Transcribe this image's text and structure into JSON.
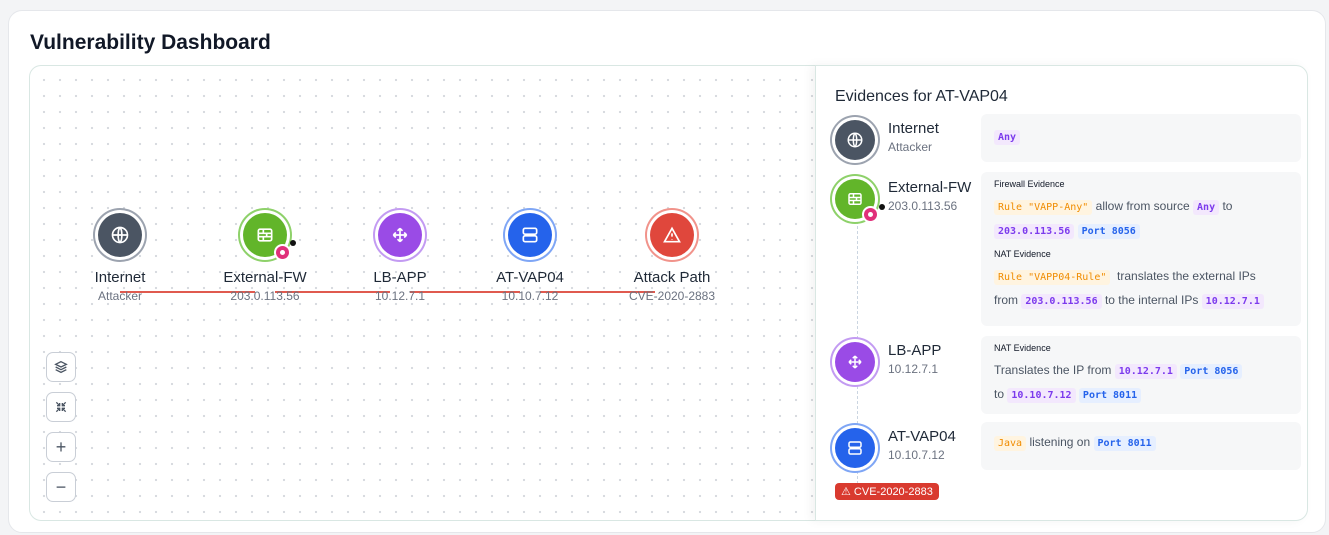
{
  "page": {
    "title": "Vulnerability Dashboard"
  },
  "graph": {
    "nodes": [
      {
        "name": "Internet",
        "sub": "Attacker",
        "icon": "globe-icon"
      },
      {
        "name": "External-FW",
        "sub": "203.0.113.56",
        "icon": "firewall-icon"
      },
      {
        "name": "LB-APP",
        "sub": "10.12.7.1",
        "icon": "load-balancer-icon"
      },
      {
        "name": "AT-VAP04",
        "sub": "10.10.7.12",
        "icon": "server-icon"
      },
      {
        "name": "Attack Path",
        "sub": "CVE-2020-2883",
        "icon": "warning-icon"
      }
    ],
    "controls": [
      "layers-icon",
      "collapse-icon",
      "zoom-in-icon",
      "zoom-out-icon"
    ],
    "zoom_in_label": "+",
    "zoom_out_label": "−"
  },
  "panel": {
    "title": "Evidences for AT-VAP04",
    "nodes": [
      {
        "name": "Internet",
        "sub": "Attacker"
      },
      {
        "name": "External-FW",
        "sub": "203.0.113.56"
      },
      {
        "name": "LB-APP",
        "sub": "10.12.7.1"
      },
      {
        "name": "AT-VAP04",
        "sub": "10.10.7.12"
      }
    ],
    "cve_badge": "CVE-2020-2883",
    "evidence": {
      "internet": {
        "any": "Any"
      },
      "fw": {
        "heading1": "Firewall Evidence",
        "rule1": "Rule \"VAPP-Any\"",
        "t1": "allow from source",
        "any": "Any",
        "t2": "to",
        "ip": "203.0.113.56",
        "port": "Port 8056",
        "heading2": "NAT Evidence",
        "rule2": "Rule \"VAPP04-Rule\"",
        "t3": "translates the external IPs",
        "t4": "from",
        "ip_from": "203.0.113.56",
        "t5": "to the internal IPs",
        "ip_to": "10.12.7.1"
      },
      "lb": {
        "heading": "NAT Evidence",
        "t1": "Translates the IP from",
        "ip1": "10.12.7.1",
        "port1": "Port 8056",
        "t2": "to",
        "ip2": "10.10.7.12",
        "port2": "Port 8011"
      },
      "vap": {
        "lang": "Java",
        "t1": "listening on",
        "port": "Port 8011"
      }
    }
  },
  "colors": {
    "edge": "#e05a4f",
    "cve": "#d93a2f",
    "accent_purple": "#7c3aed",
    "accent_blue": "#2563eb"
  }
}
